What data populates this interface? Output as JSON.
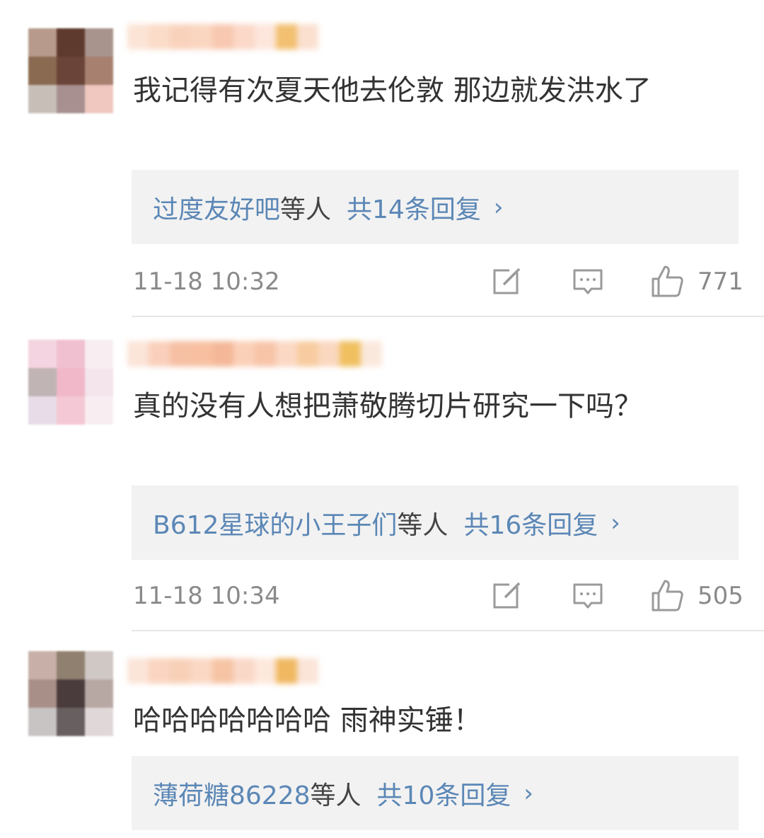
{
  "comments": [
    {
      "text": "我记得有次夏天他去伦敦 那边就发洪水了",
      "avatar_colors": [
        "#b89a8c",
        "#5e3a2e",
        "#a8948c",
        "#8a6a50",
        "#6a4438",
        "#a88070",
        "#c8beb8",
        "#a89090",
        "#f0c8c0"
      ],
      "name_colors": [
        "#fbe4d6",
        "#fbdcc8",
        "#f9d2bc",
        "#fad6c0",
        "#f8c8b0",
        "#fbd8c8",
        "#fde6dc",
        "#f2c070",
        "#fbe0d0"
      ],
      "reply_names": "过度友好吧",
      "reply_etal": "等人",
      "reply_total": "共14条回复",
      "reply_chevron": "›",
      "timestamp": "11-18 10:32",
      "likes": "771"
    },
    {
      "text": "真的没有人想把萧敬腾切片研究一下吗？",
      "avatar_colors": [
        "#f4d4e0",
        "#f0c0d0",
        "#f8eef2",
        "#c0b4b4",
        "#f0b8c8",
        "#f4e4ec",
        "#e8dce8",
        "#f4c8d4",
        "#f8eef2"
      ],
      "name_colors": [
        "#fbe4d8",
        "#fad0bc",
        "#f6c0a4",
        "#f8c0a0",
        "#f4b898",
        "#fbd0b8",
        "#f8c4a8",
        "#fbd8c4",
        "#f8cca0",
        "#fad8c0",
        "#f0c060",
        "#fbe8dc"
      ],
      "reply_names": "B612星球的小王子们",
      "reply_etal": "等人",
      "reply_total": "共16条回复",
      "reply_chevron": "›",
      "timestamp": "11-18 10:34",
      "likes": "505"
    },
    {
      "text": "哈哈哈哈哈哈哈 雨神实锤！",
      "avatar_colors": [
        "#c8b0a8",
        "#908070",
        "#d0c8c4",
        "#a89088",
        "#4a3c3c",
        "#b8a8a4",
        "#c8c4c4",
        "#686060",
        "#e0d8d8"
      ],
      "name_colors": [
        "#fbe4d8",
        "#fad4c0",
        "#f8d0b8",
        "#fad8c4",
        "#f6c4a4",
        "#fad8c8",
        "#fde8dc",
        "#f0b860",
        "#fbe4d8"
      ],
      "reply_names": "薄荷糖86228",
      "reply_etal": "等人",
      "reply_total": "共10条回复",
      "reply_chevron": "›",
      "timestamp": "",
      "likes": ""
    }
  ],
  "icons": {
    "edit": "edit-icon",
    "comment": "comment-icon",
    "like": "thumbs-up-icon"
  },
  "colors": {
    "link_blue": "#5b87b6",
    "reply_box_bg": "#f2f2f2",
    "meta_gray": "#8a8a8a"
  }
}
